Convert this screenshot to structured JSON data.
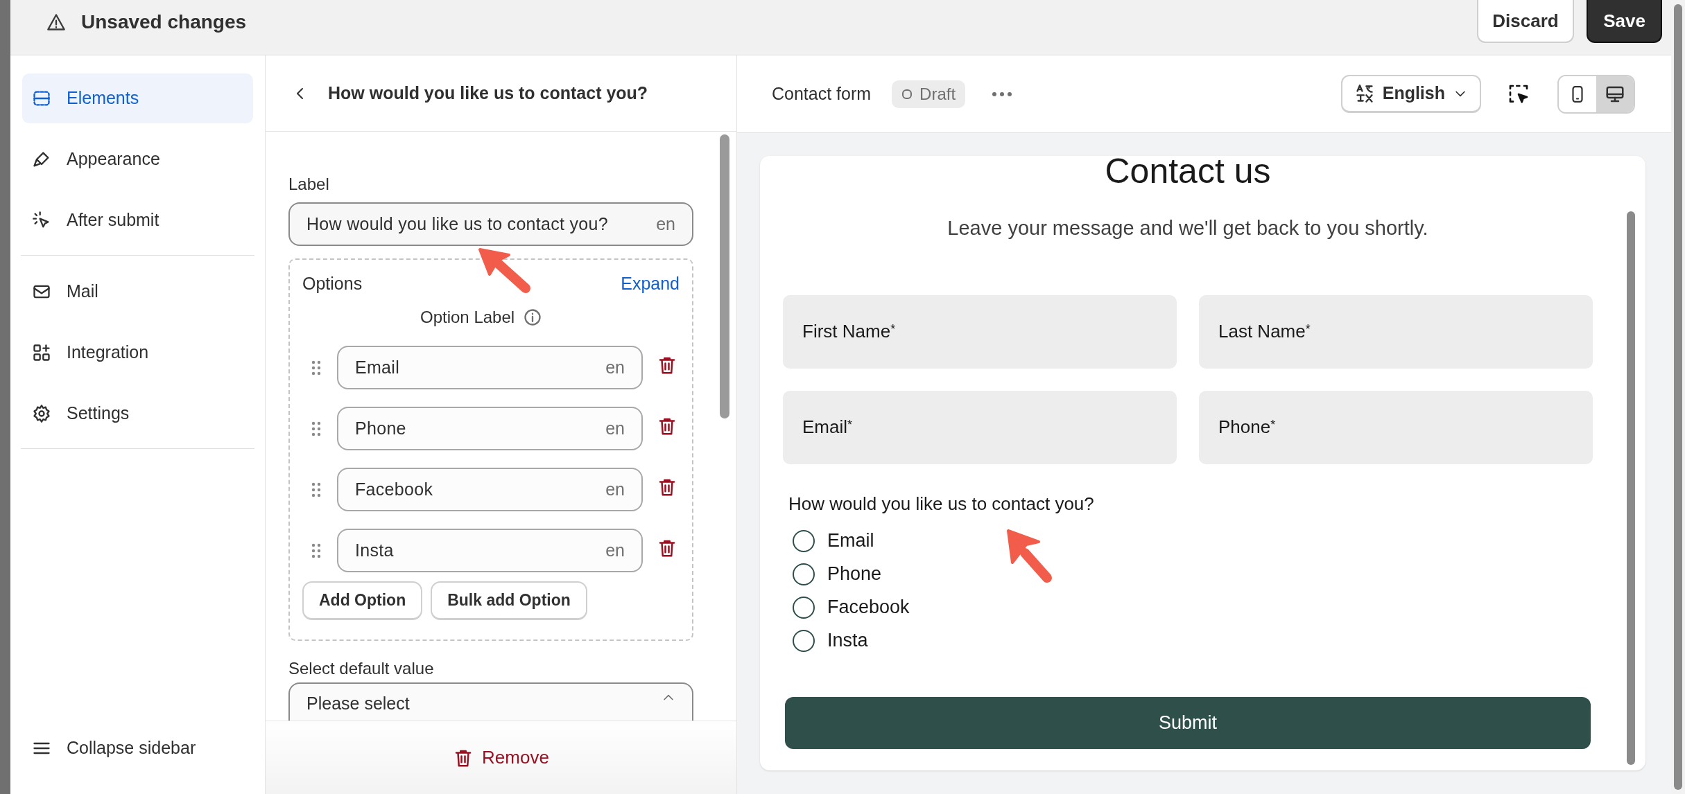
{
  "header": {
    "title": "Unsaved changes",
    "buttons": [
      {
        "label": "Discard",
        "kind": "secondary"
      },
      {
        "label": "Save",
        "kind": "primary"
      }
    ]
  },
  "sidebar": {
    "groups": [
      [
        {
          "label": "Elements",
          "selected": true
        },
        {
          "label": "Appearance",
          "selected": false
        },
        {
          "label": "After submit",
          "selected": false
        }
      ],
      [
        {
          "label": "Mail",
          "selected": false
        },
        {
          "label": "Integration",
          "selected": false
        },
        {
          "label": "Settings",
          "selected": false
        }
      ]
    ],
    "collapse": "Collapse sidebar"
  },
  "editor": {
    "title": "How would you like us to contact you?",
    "label_caption": "Label",
    "label_value": "How would you like us to contact you?",
    "label_lang": "en",
    "options_title": "Options",
    "expand": "Expand",
    "option_label_header": "Option Label",
    "options": [
      {
        "value": "Email",
        "lang": "en"
      },
      {
        "value": "Phone",
        "lang": "en"
      },
      {
        "value": "Facebook",
        "lang": "en"
      },
      {
        "value": "Insta",
        "lang": "en"
      }
    ],
    "option_buttons": [
      "Add Option",
      "Bulk add Option"
    ],
    "default_caption": "Select default value",
    "default_placeholder": "Please select",
    "remove": "Remove"
  },
  "preview": {
    "form_name": "Contact form",
    "status": "Draft",
    "language": "English",
    "devices": [
      {
        "selected": false
      },
      {
        "selected": true
      }
    ],
    "form": {
      "title": "Contact us",
      "subtitle": "Leave your message and we'll get back to you shortly.",
      "fields": [
        {
          "label": "First Name",
          "mark": "*"
        },
        {
          "label": "Last Name",
          "mark": "*"
        },
        {
          "label": "Email",
          "mark": "*"
        },
        {
          "label": "Phone",
          "mark": "*"
        }
      ],
      "question": "How would you like us to contact you?",
      "choices": [
        {
          "label": "Email",
          "selected": false
        },
        {
          "label": "Phone",
          "selected": false
        },
        {
          "label": "Facebook",
          "selected": false
        },
        {
          "label": "Insta",
          "selected": false
        }
      ],
      "submit": "Submit"
    }
  }
}
